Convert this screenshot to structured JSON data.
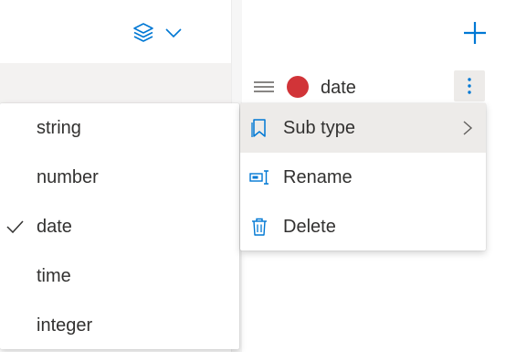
{
  "colors": {
    "accent": "#0078d4",
    "date_dot": "#d13438",
    "menu_hover": "#edebe9"
  },
  "header": {
    "layers_icon": "layers-icon",
    "dropdown_icon": "chevron-down-icon",
    "add_icon": "plus-icon"
  },
  "field": {
    "name": "date",
    "handle_icon": "drag-handle-icon",
    "more_icon": "more-vertical-icon"
  },
  "type_menu": {
    "items": [
      {
        "label": "string",
        "checked": false
      },
      {
        "label": "number",
        "checked": false
      },
      {
        "label": "date",
        "checked": true
      },
      {
        "label": "time",
        "checked": false
      },
      {
        "label": "integer",
        "checked": false
      }
    ]
  },
  "context_menu": {
    "items": [
      {
        "label": "Sub type",
        "icon": "bookmark-icon",
        "submenu": true,
        "active": true
      },
      {
        "label": "Rename",
        "icon": "rename-icon",
        "submenu": false,
        "active": false
      },
      {
        "label": "Delete",
        "icon": "trash-icon",
        "submenu": false,
        "active": false
      }
    ]
  }
}
